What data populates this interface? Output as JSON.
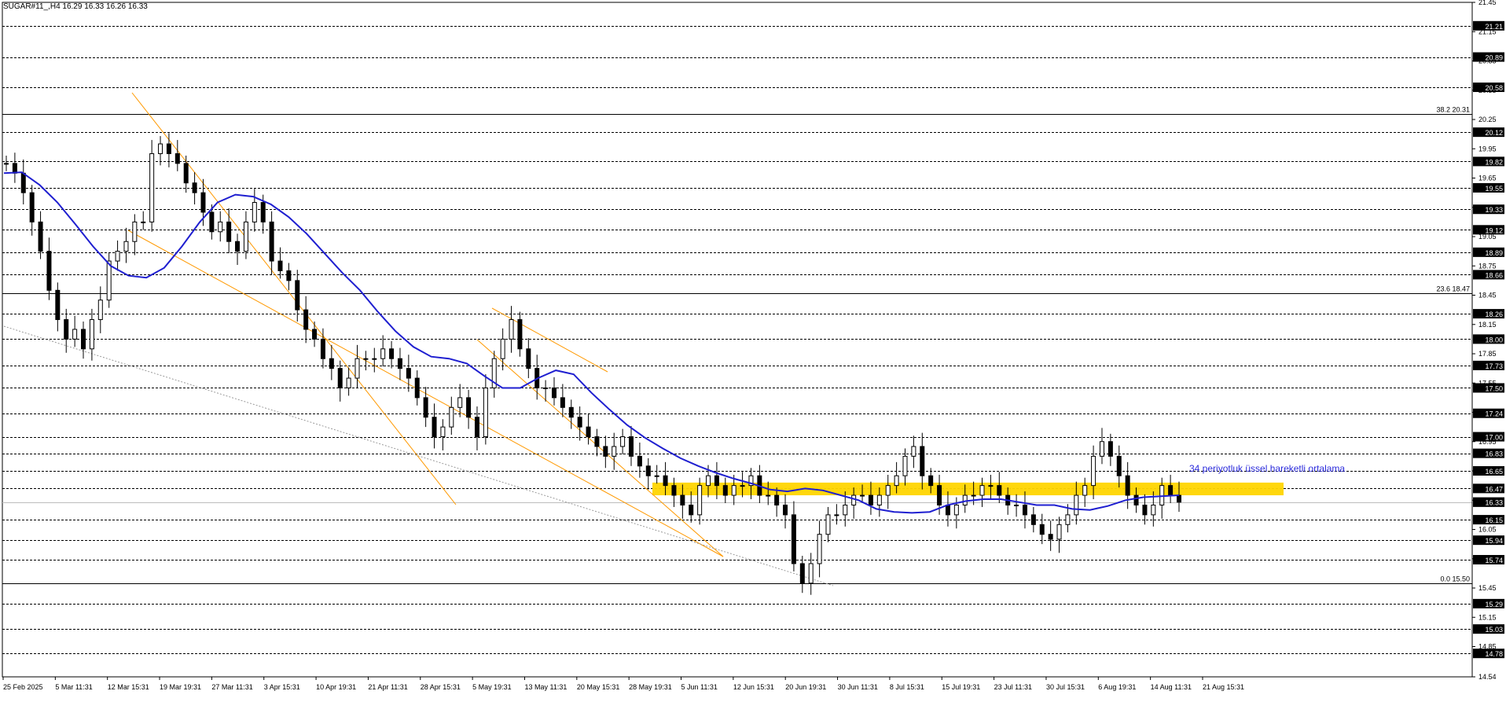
{
  "chart_header": "SUGAR#11_,H4  16.29 16.33 16.26 16.33",
  "annotation": "34 periyotluk üssel hareketli ortalama",
  "colors": {
    "background": "#ffffff",
    "candle": "#000000",
    "ema": "#1f1fd0",
    "channel": "#ff9900",
    "zone": "#ffd500",
    "grid": "#000000",
    "trendline": "#9a9a9a",
    "price_tag_bg": "#000000",
    "price_tag_text": "#ffffff"
  },
  "chart_data": {
    "type": "candlestick",
    "symbol": "SUGAR#11_",
    "timeframe": "H4",
    "ohlc_last": {
      "open": 16.29,
      "high": 16.33,
      "low": 16.26,
      "close": 16.33
    },
    "y_range": [
      14.54,
      21.45
    ],
    "y_ticks": [
      "21.45",
      "21.15",
      "20.85",
      "20.55",
      "20.25",
      "19.95",
      "19.65",
      "19.35",
      "19.05",
      "18.75",
      "18.45",
      "18.15",
      "17.85",
      "17.55",
      "17.25",
      "16.95",
      "16.65",
      "16.35",
      "16.05",
      "15.75",
      "15.45",
      "15.15",
      "14.85",
      "14.54"
    ],
    "x_ticks": [
      "25 Feb 2025",
      "5 Mar 11:31",
      "12 Mar 15:31",
      "19 Mar 19:31",
      "27 Mar 11:31",
      "3 Apr 15:31",
      "10 Apr 19:31",
      "21 Apr 11:31",
      "28 Apr 15:31",
      "5 May 19:31",
      "13 May 11:31",
      "20 May 15:31",
      "28 May 19:31",
      "5 Jun 11:31",
      "12 Jun 15:31",
      "20 Jun 19:31",
      "30 Jun 11:31",
      "8 Jul 15:31",
      "15 Jul 19:31",
      "23 Jul 11:31",
      "30 Jul 15:31",
      "6 Aug 19:31",
      "14 Aug 11:31",
      "21 Aug 15:31"
    ],
    "horizontal_levels": [
      21.21,
      20.89,
      20.58,
      20.12,
      19.82,
      19.55,
      19.33,
      19.12,
      18.89,
      18.66,
      18.26,
      18.0,
      17.73,
      17.5,
      17.24,
      17.0,
      16.83,
      16.65,
      16.47,
      16.33,
      16.15,
      15.94,
      15.74,
      15.29,
      15.03,
      14.78
    ],
    "fib_levels": [
      {
        "label": "38.2 20.31",
        "value": 20.31
      },
      {
        "label": "23.6 18.47",
        "value": 18.47
      },
      {
        "label": "0.0 15.50",
        "value": 15.5
      }
    ],
    "current_price": 16.33,
    "support_zone": [
      16.4,
      16.53
    ],
    "ema_period": 34,
    "series_close": [
      19.8,
      19.7,
      19.5,
      19.2,
      18.9,
      18.5,
      18.2,
      18.0,
      18.1,
      17.9,
      18.2,
      18.4,
      18.8,
      18.9,
      19.0,
      19.2,
      19.2,
      19.9,
      20.0,
      19.9,
      19.8,
      19.6,
      19.5,
      19.3,
      19.1,
      19.2,
      19.0,
      18.9,
      19.2,
      19.4,
      19.2,
      18.8,
      18.7,
      18.6,
      18.3,
      18.1,
      18.0,
      17.8,
      17.7,
      17.5,
      17.6,
      17.8,
      17.8,
      17.8,
      17.9,
      17.8,
      17.7,
      17.6,
      17.4,
      17.2,
      17.0,
      17.1,
      17.3,
      17.4,
      17.2,
      17.0,
      17.5,
      17.8,
      18.0,
      18.2,
      17.9,
      17.7,
      17.5,
      17.5,
      17.4,
      17.3,
      17.2,
      17.1,
      17.0,
      16.9,
      16.8,
      16.9,
      17.0,
      16.8,
      16.7,
      16.6,
      16.6,
      16.5,
      16.4,
      16.3,
      16.2,
      16.5,
      16.6,
      16.5,
      16.4,
      16.5,
      16.5,
      16.6,
      16.4,
      16.4,
      16.3,
      16.2,
      15.7,
      15.5,
      15.7,
      16.0,
      16.2,
      16.2,
      16.3,
      16.4,
      16.4,
      16.3,
      16.4,
      16.5,
      16.6,
      16.8,
      16.9,
      16.6,
      16.5,
      16.3,
      16.2,
      16.3,
      16.4,
      16.4,
      16.5,
      16.5,
      16.4,
      16.3,
      16.3,
      16.2,
      16.1,
      16.0,
      15.95,
      16.1,
      16.2,
      16.4,
      16.5,
      16.8,
      16.95,
      16.8,
      16.6,
      16.4,
      16.3,
      16.2,
      16.3,
      16.5,
      16.4,
      16.33
    ],
    "ema_values": [
      19.7,
      19.71,
      19.58,
      19.4,
      19.18,
      18.95,
      18.75,
      18.65,
      18.63,
      18.73,
      18.95,
      19.2,
      19.4,
      19.48,
      19.46,
      19.38,
      19.25,
      19.08,
      18.88,
      18.68,
      18.5,
      18.28,
      18.08,
      17.92,
      17.82,
      17.8,
      17.75,
      17.62,
      17.5,
      17.5,
      17.6,
      17.68,
      17.64,
      17.45,
      17.28,
      17.12,
      16.99,
      16.88,
      16.78,
      16.7,
      16.63,
      16.57,
      16.52,
      16.46,
      16.44,
      16.47,
      16.45,
      16.4,
      16.35,
      16.26,
      16.23,
      16.22,
      16.23,
      16.3,
      16.34,
      16.36,
      16.36,
      16.33,
      16.3,
      16.3,
      16.26,
      16.25,
      16.29,
      16.35,
      16.38,
      16.39,
      16.4
    ],
    "annotations": [
      "34 periyotluk üssel hareketli ortalama"
    ]
  }
}
